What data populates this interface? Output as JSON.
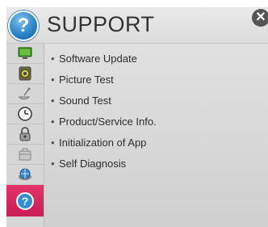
{
  "header": {
    "title": "SUPPORT",
    "icon_glyph": "?",
    "close_glyph": "✕",
    "icon_name": "help-question-icon",
    "accent_color": "#2b87c9"
  },
  "sidebar": {
    "active_color": "#d92460",
    "items": [
      {
        "icon": "picture-tv-icon",
        "label": ""
      },
      {
        "icon": "sound-speaker-icon",
        "label": ""
      },
      {
        "icon": "channel-satellite-icon",
        "label": ""
      },
      {
        "icon": "time-clock-icon",
        "label": ""
      },
      {
        "icon": "lock-icon",
        "label": ""
      },
      {
        "icon": "option-briefcase-icon",
        "label": ""
      },
      {
        "icon": "network-globe-icon",
        "label": ""
      },
      {
        "icon": "support-question-icon",
        "label": "",
        "active": true
      }
    ]
  },
  "menu": {
    "bullet": "•",
    "items": [
      {
        "label": "Software Update"
      },
      {
        "label": "Picture Test"
      },
      {
        "label": "Sound Test"
      },
      {
        "label": "Product/Service Info."
      },
      {
        "label": "Initialization of App"
      },
      {
        "label": "Self Diagnosis"
      }
    ]
  }
}
